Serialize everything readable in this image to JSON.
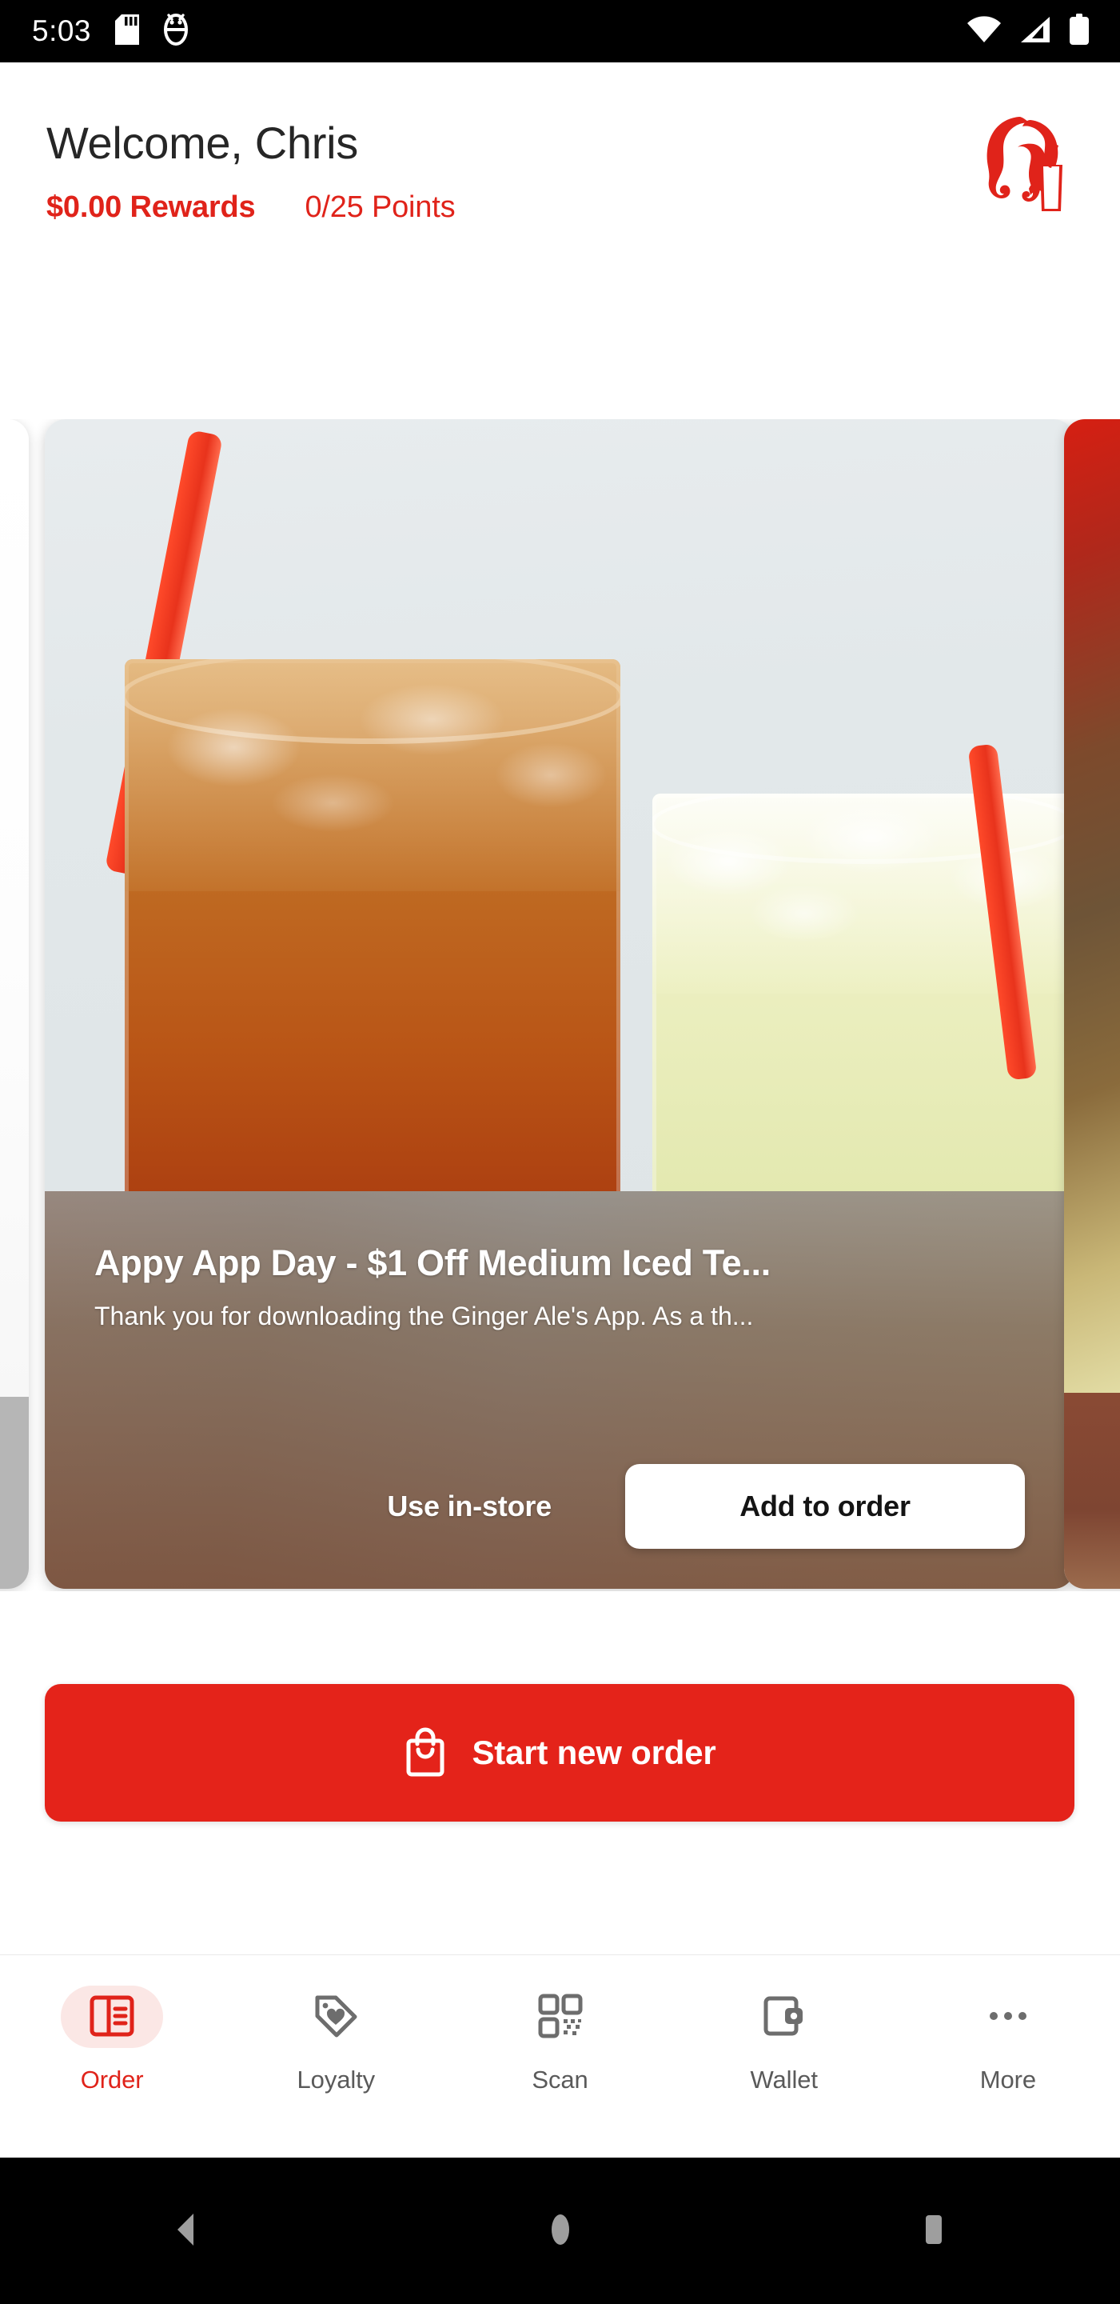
{
  "status_bar": {
    "time": "5:03",
    "left_icons": [
      "sd-card-icon",
      "android-debug-icon"
    ],
    "right_icons": [
      "wifi-icon",
      "cellular-signal-icon",
      "battery-icon"
    ]
  },
  "header": {
    "greeting": "Welcome, Chris",
    "rewards_amount": "$0.00 Rewards",
    "points": "0/25 Points",
    "logo_icon": "ginger-ales-brand-logo",
    "accent_color": "#E0231A"
  },
  "offer_card": {
    "title": "Appy App Day - $1 Off Medium Iced Te...",
    "description": "Thank you for downloading the Ginger Ale's App. As a th...",
    "use_instore_label": "Use in-store",
    "add_to_order_label": "Add to order",
    "image_alt": "iced-tea-and-lemonade-photo"
  },
  "primary_action": {
    "label": "Start new order",
    "icon": "shopping-bag-icon",
    "background_color": "#E4231A"
  },
  "tabs": [
    {
      "label": "Order",
      "icon": "menu-board-icon",
      "active": true
    },
    {
      "label": "Loyalty",
      "icon": "tag-heart-icon",
      "active": false
    },
    {
      "label": "Scan",
      "icon": "qr-code-icon",
      "active": false
    },
    {
      "label": "Wallet",
      "icon": "wallet-icon",
      "active": false
    },
    {
      "label": "More",
      "icon": "ellipsis-icon",
      "active": false
    }
  ],
  "system_nav": {
    "back": "back-button",
    "home": "home-button",
    "recents": "recents-button"
  }
}
